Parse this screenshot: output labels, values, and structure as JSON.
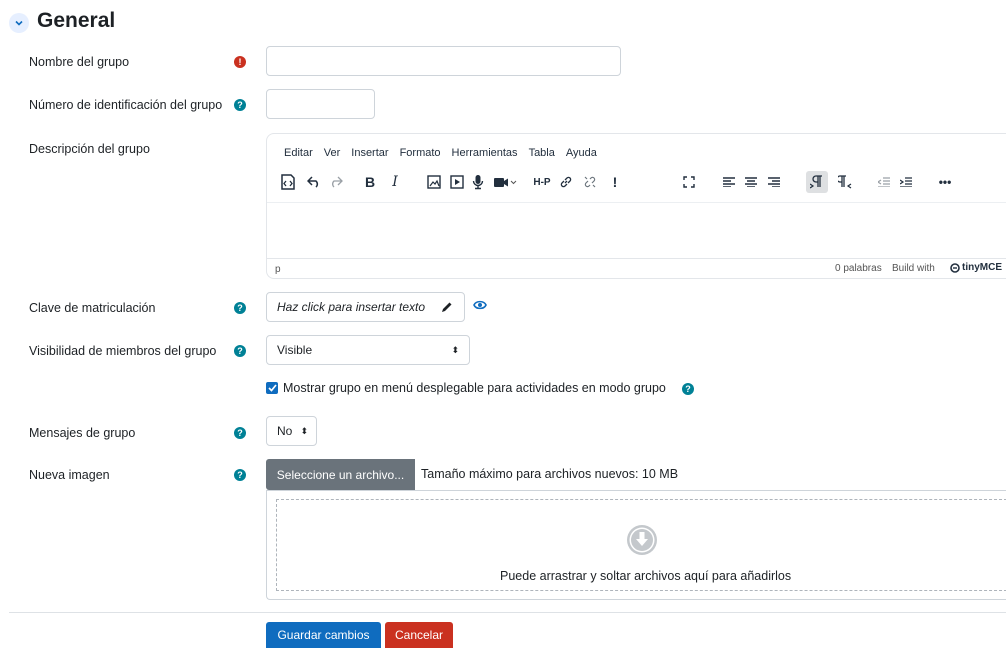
{
  "section": {
    "title": "General"
  },
  "fields": {
    "group_name": {
      "label": "Nombre del grupo",
      "value": ""
    },
    "id_number": {
      "label": "Número de identificación del grupo",
      "value": ""
    },
    "description": {
      "label": "Descripción del grupo",
      "menu": [
        "Editar",
        "Ver",
        "Insertar",
        "Formato",
        "Herramientas",
        "Tabla",
        "Ayuda"
      ],
      "path": "p",
      "word_count": "0 palabras",
      "build_with": "Build with",
      "brand": "tinyMCE"
    },
    "enrolment_key": {
      "label": "Clave de matriculación",
      "placeholder": "Haz click para insertar texto"
    },
    "visibility": {
      "label": "Visibilidad de miembros del grupo",
      "selected": "Visible"
    },
    "dropdown_checkbox": {
      "label": "Mostrar grupo en menú desplegable para actividades en modo grupo",
      "checked": true
    },
    "messaging": {
      "label": "Mensajes de grupo",
      "selected": "No"
    },
    "image": {
      "label": "Nueva imagen",
      "button": "Seleccione un archivo...",
      "max_size": "Tamaño máximo para archivos nuevos: 10 MB",
      "drop_text": "Puede arrastrar y soltar archivos aquí para añadirlos"
    }
  },
  "actions": {
    "save": "Guardar cambios",
    "cancel": "Cancelar"
  },
  "colors": {
    "primary": "#0f6cbf",
    "danger": "#ca3120",
    "info": "#008196",
    "secondary": "#6a737b"
  }
}
